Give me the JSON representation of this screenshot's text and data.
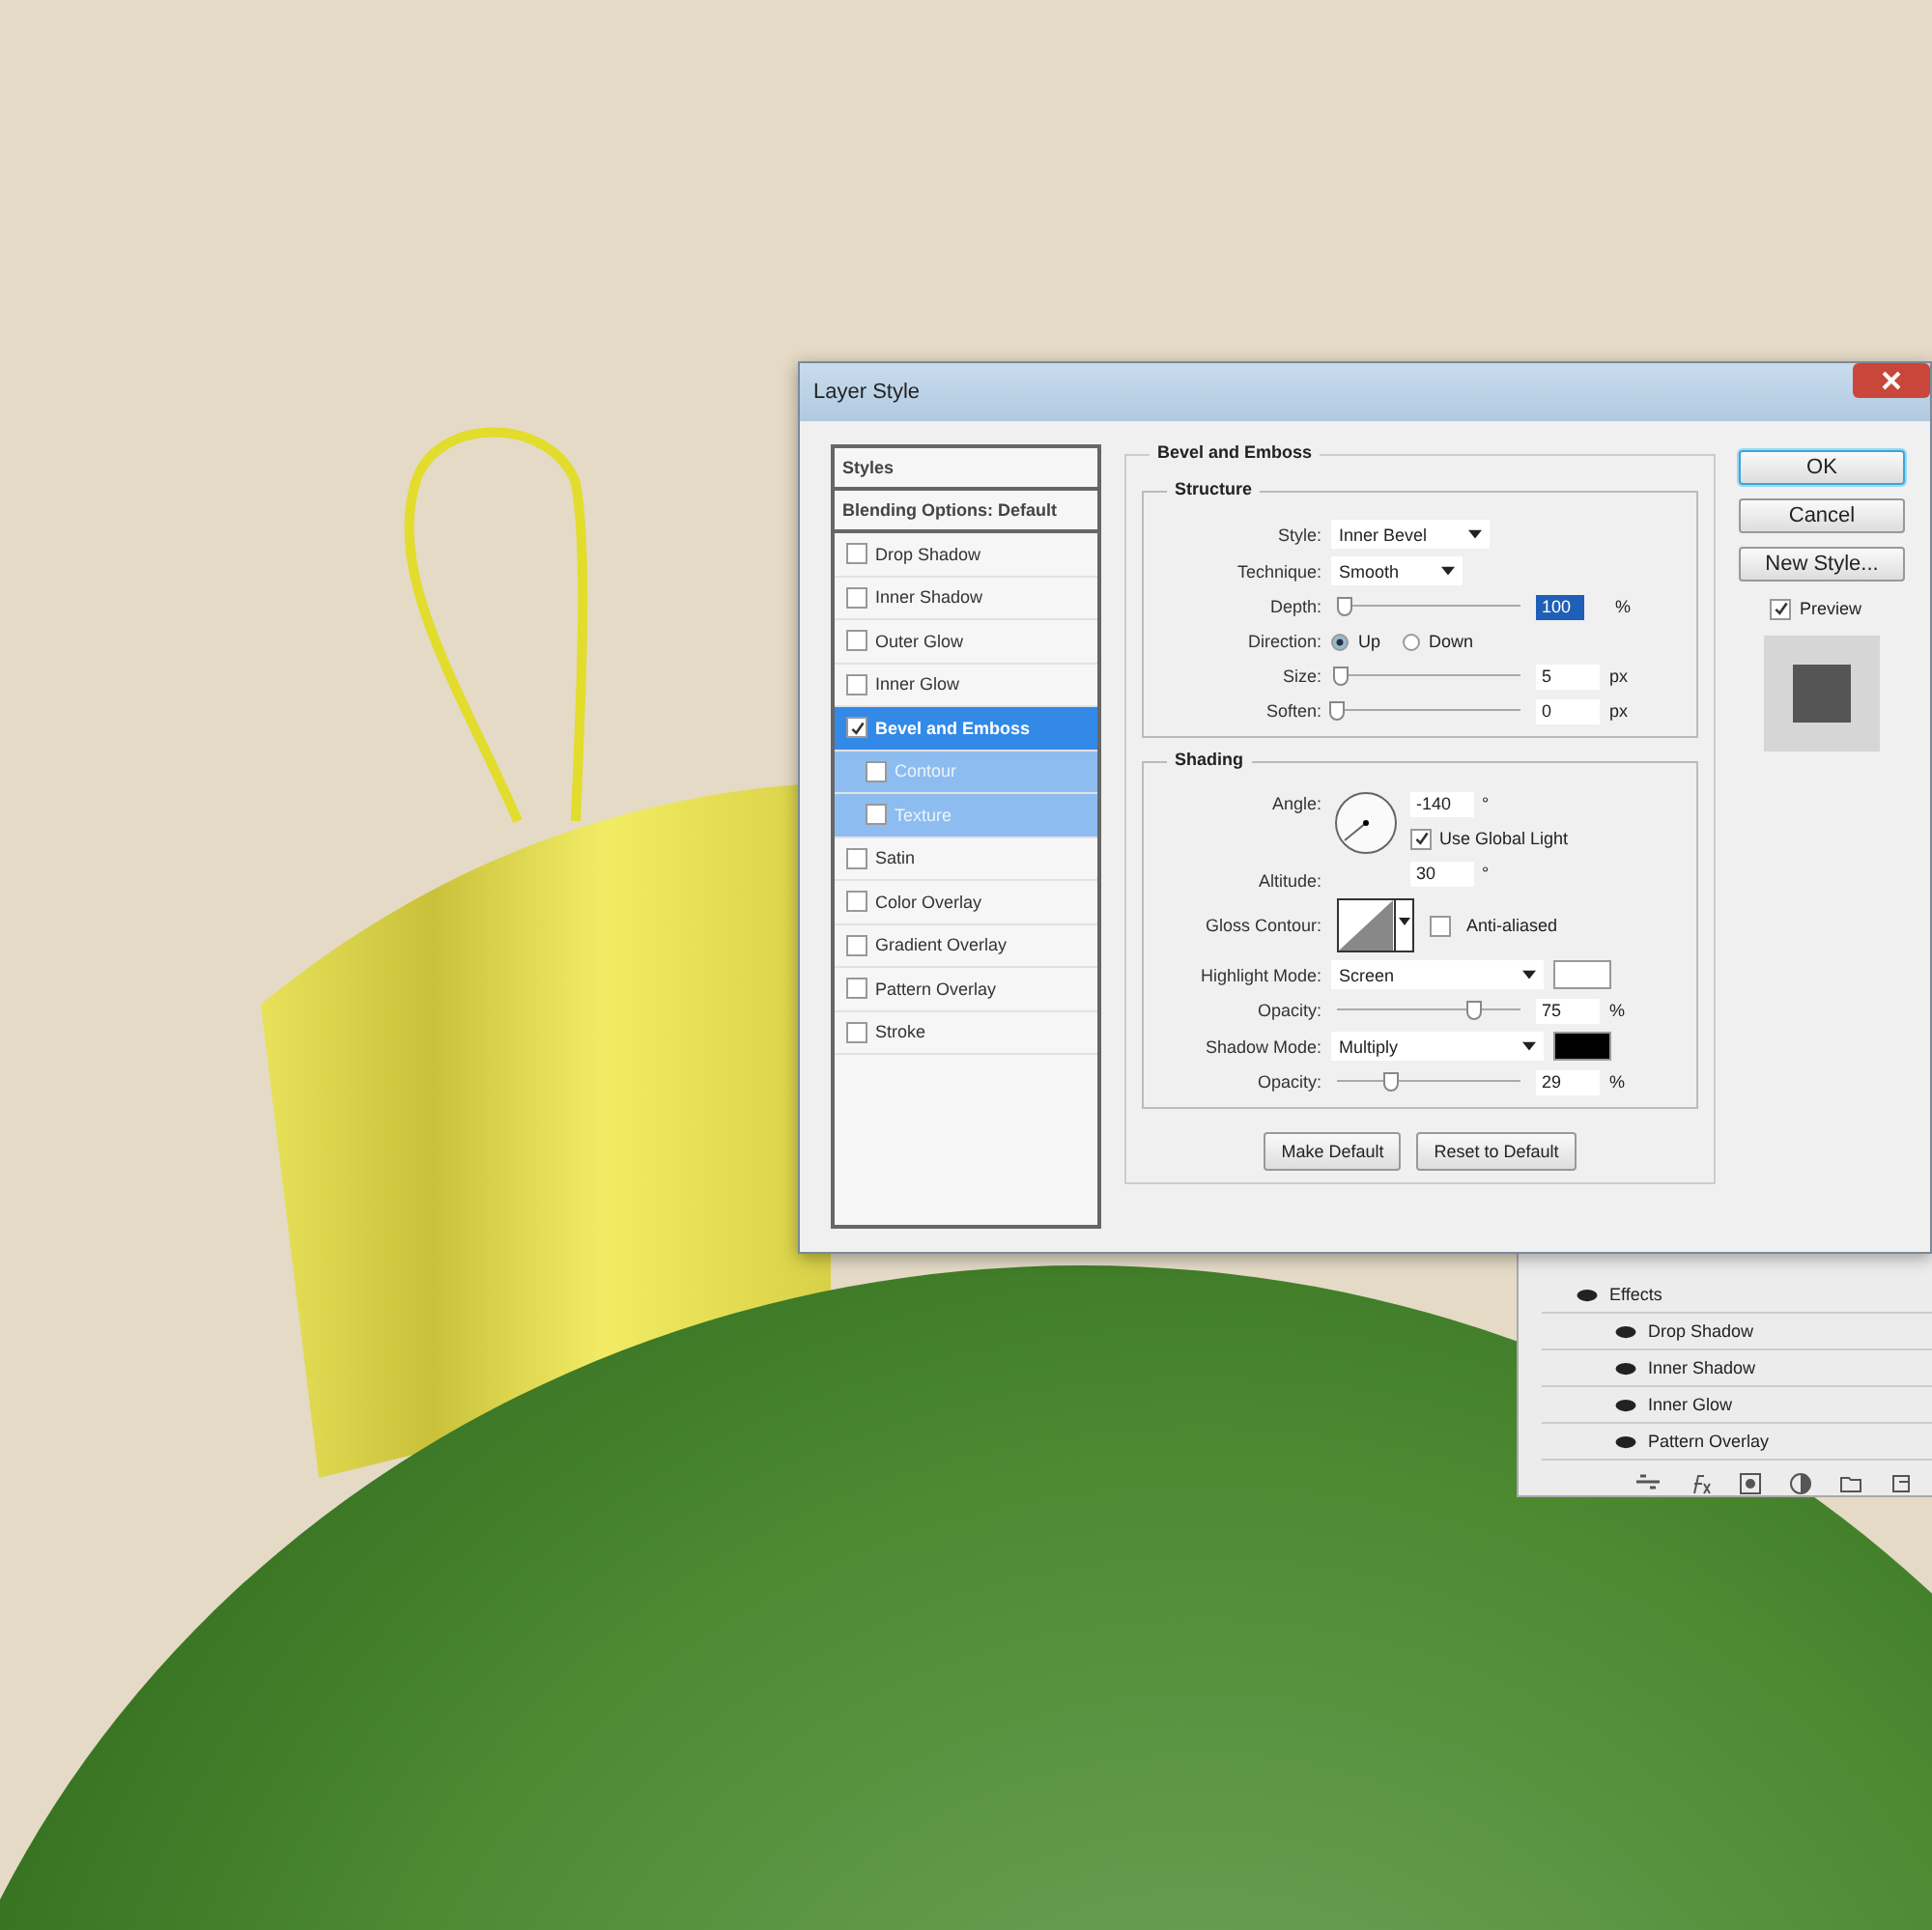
{
  "dialog": {
    "title": "Layer Style",
    "styles_list": [
      {
        "label": "Styles",
        "kind": "header"
      },
      {
        "label": "Blending Options: Default",
        "kind": "header"
      },
      {
        "label": "Drop Shadow",
        "kind": "effect",
        "checked": false,
        "selected": false
      },
      {
        "label": "Inner Shadow",
        "kind": "effect",
        "checked": false,
        "selected": false
      },
      {
        "label": "Outer Glow",
        "kind": "effect",
        "checked": false,
        "selected": false
      },
      {
        "label": "Inner Glow",
        "kind": "effect",
        "checked": false,
        "selected": false
      },
      {
        "label": "Bevel and Emboss",
        "kind": "effect",
        "checked": true,
        "selected": true
      },
      {
        "label": "Contour",
        "kind": "sub",
        "checked": false,
        "selected": false
      },
      {
        "label": "Texture",
        "kind": "sub",
        "checked": false,
        "selected": false
      },
      {
        "label": "Satin",
        "kind": "effect",
        "checked": false,
        "selected": false
      },
      {
        "label": "Color Overlay",
        "kind": "effect",
        "checked": false,
        "selected": false
      },
      {
        "label": "Gradient Overlay",
        "kind": "effect",
        "checked": false,
        "selected": false
      },
      {
        "label": "Pattern Overlay",
        "kind": "effect",
        "checked": false,
        "selected": false
      },
      {
        "label": "Stroke",
        "kind": "effect",
        "checked": false,
        "selected": false
      }
    ],
    "section_title": "Bevel and Emboss",
    "structure": {
      "title": "Structure",
      "style": {
        "label": "Style:",
        "value": "Inner Bevel"
      },
      "technique": {
        "label": "Technique:",
        "value": "Smooth"
      },
      "depth": {
        "label": "Depth:",
        "level": 0.04,
        "value": "100",
        "unit": "%",
        "text_selected": true
      },
      "direction": {
        "label": "Direction:",
        "options": [
          {
            "label": "Up",
            "selected": true
          },
          {
            "label": "Down",
            "selected": false
          }
        ]
      },
      "size": {
        "label": "Size:",
        "level": 0.02,
        "value": "5",
        "unit": "px"
      },
      "soften": {
        "label": "Soften:",
        "level": 0,
        "value": "0",
        "unit": "px"
      }
    },
    "shading": {
      "title": "Shading",
      "angle": {
        "label": "Angle:",
        "value": "-140",
        "unit": "°"
      },
      "use_global_light": {
        "label": "Use Global Light",
        "checked": true
      },
      "altitude": {
        "label": "Altitude:",
        "value": "30",
        "unit": "°"
      },
      "gloss_contour": {
        "label": "Gloss Contour:"
      },
      "anti_aliased": {
        "label": "Anti-aliased",
        "checked": false
      },
      "highlight_mode": {
        "label": "Highlight Mode:",
        "value": "Screen",
        "color": "#ffffff"
      },
      "highlight_opacity": {
        "label": "Opacity:",
        "level": 0.75,
        "value": "75",
        "unit": "%"
      },
      "shadow_mode": {
        "label": "Shadow Mode:",
        "value": "Multiply",
        "color": "#000000"
      },
      "shadow_opacity": {
        "label": "Opacity:",
        "level": 0.29,
        "value": "29",
        "unit": "%"
      }
    },
    "footer_buttons": [
      "Make Default",
      "Reset to Default"
    ],
    "side_buttons": [
      {
        "label": "OK",
        "default": true
      },
      {
        "label": "Cancel",
        "default": false
      },
      {
        "label": "New Style...",
        "default": false
      }
    ],
    "preview": {
      "label": "Preview",
      "checked": true
    }
  },
  "layers_panel": {
    "effects_label": "Effects",
    "effects": [
      "Drop Shadow",
      "Inner Shadow",
      "Inner Glow",
      "Pattern Overlay"
    ]
  }
}
